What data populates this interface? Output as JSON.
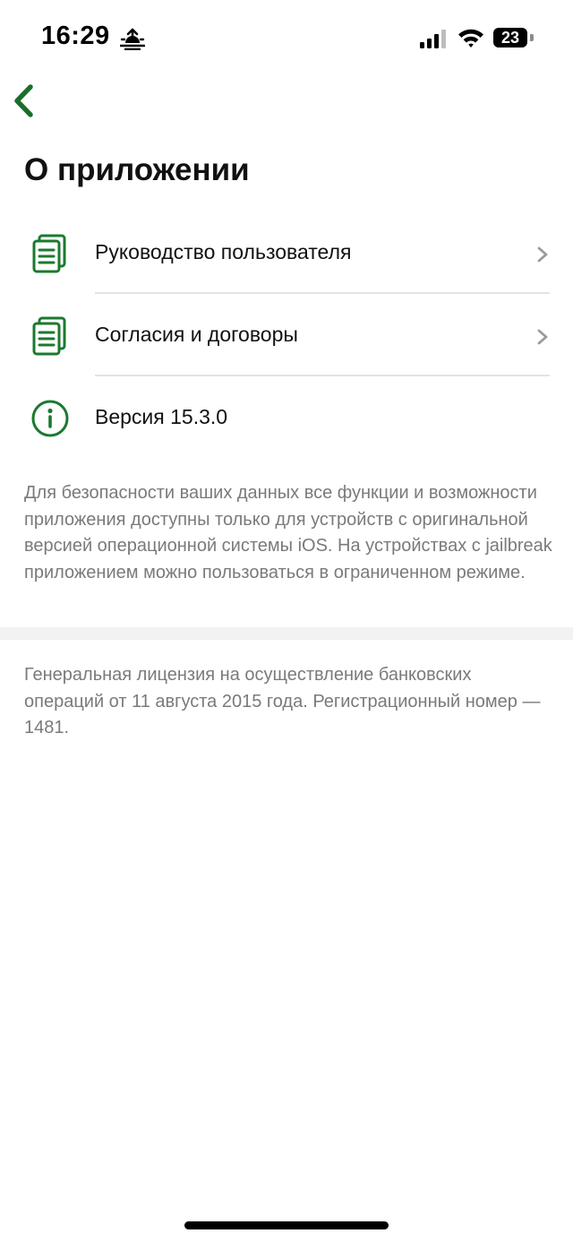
{
  "status_bar": {
    "time": "16:29",
    "battery": "23"
  },
  "header": {
    "title": "О приложении"
  },
  "menu": {
    "items": [
      {
        "label": "Руководство пользователя",
        "icon": "documents-icon",
        "has_chevron": true
      },
      {
        "label": "Согласия и договоры",
        "icon": "documents-icon",
        "has_chevron": true
      },
      {
        "label": "Версия 15.3.0",
        "icon": "info-icon",
        "has_chevron": false
      }
    ]
  },
  "security_note": "Для безопасности ваших данных все функции и возможности приложения доступны только для устройств с оригинальной версией операционной системы iOS. На устройствах с jailbreak приложением можно пользоваться в ограниченном режиме.",
  "license_note": "Генеральная лицензия на осуществление банковских операций от 11 августа 2015 года. Регистрационный номер — 1481.",
  "colors": {
    "accent": "#1a7a2e",
    "secondary_text": "#7a7a7a",
    "divider": "#e4e4e4",
    "section_background": "#f2f2f2"
  }
}
